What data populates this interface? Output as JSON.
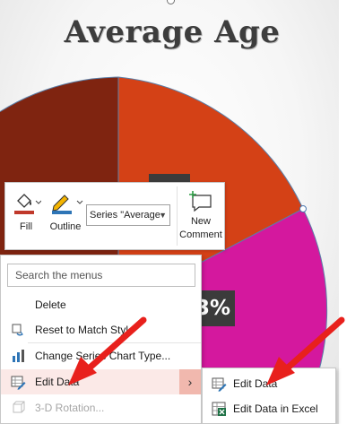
{
  "chart": {
    "title": "Average Age",
    "data_label": "3%"
  },
  "chart_data": {
    "type": "pie",
    "title": "Average Age",
    "data_labels": [
      "3%"
    ],
    "slice_colors": [
      "#7f2410",
      "#d44116",
      "#d4189e",
      "#d9d9d9"
    ]
  },
  "mini_toolbar": {
    "fill_label": "Fill",
    "outline_label": "Outline",
    "series_value": "Series \"Average",
    "comment_label_1": "New",
    "comment_label_2": "Comment",
    "colors": {
      "fill": "#c0392b",
      "outline": "#2e75b6"
    }
  },
  "context_menu": {
    "search_placeholder": "Search the menus",
    "items": [
      {
        "label": "Delete",
        "icon": "none"
      },
      {
        "label": "Reset to Match Style",
        "icon": "reset-style-icon"
      },
      {
        "label": "Change Series Chart Type...",
        "icon": "chart-type-icon"
      },
      {
        "label": "Edit Data",
        "icon": "edit-data-icon",
        "selected": true,
        "has_submenu": true
      },
      {
        "label": "3-D Rotation...",
        "icon": "rotation-3d-icon",
        "disabled": true
      }
    ],
    "submenu_arrow": "›"
  },
  "sub_menu": {
    "items": [
      {
        "label": "Edit Data",
        "icon": "edit-data-icon"
      },
      {
        "label": "Edit Data in Excel",
        "icon": "excel-icon"
      }
    ]
  },
  "annotations": {
    "arrow_color": "#e8201c"
  }
}
